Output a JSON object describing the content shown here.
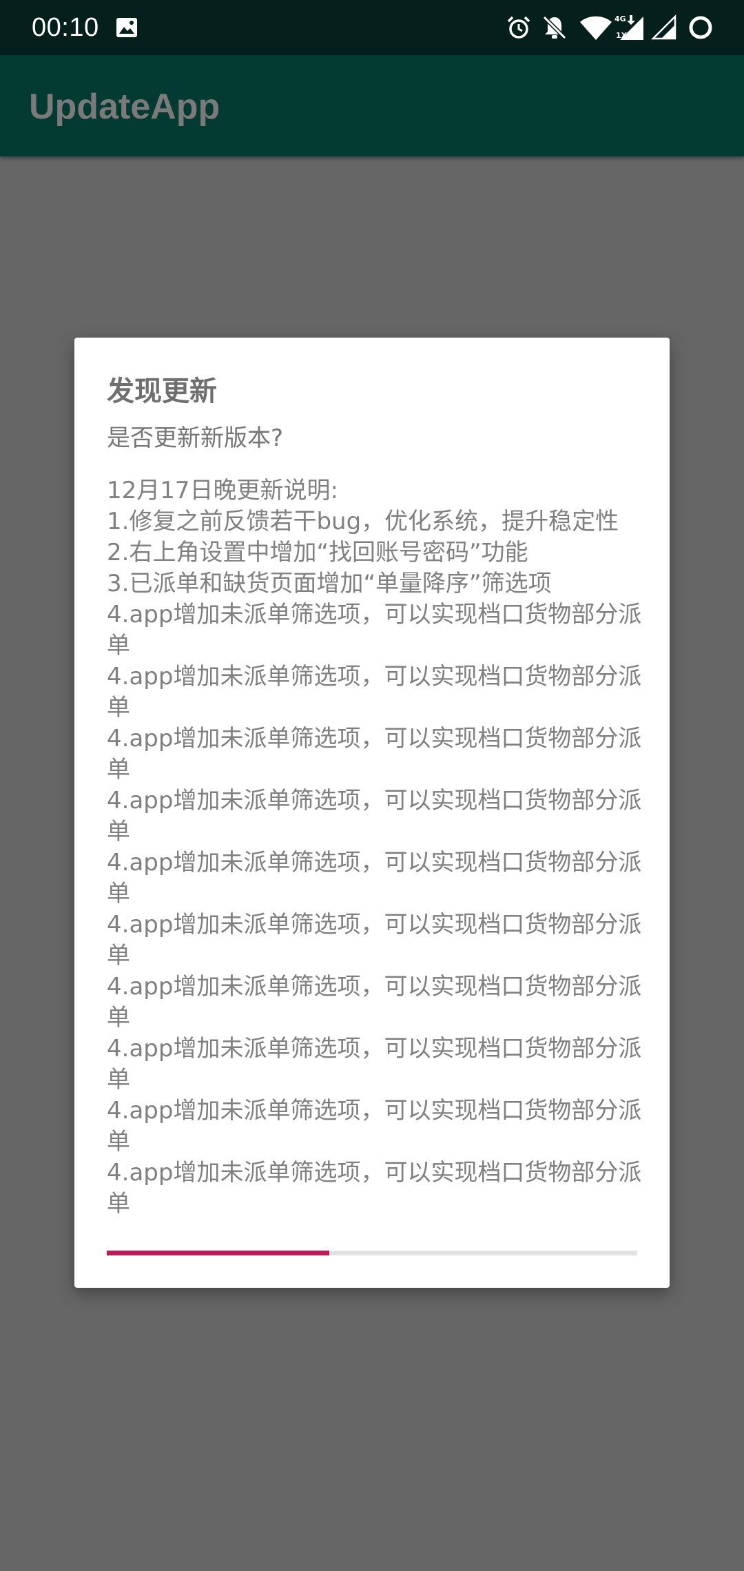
{
  "status_bar": {
    "time": "00:10",
    "icons": [
      "image-notification-icon",
      "alarm-icon",
      "notifications-off-icon",
      "wifi-icon",
      "mobile-signal-4g-icon",
      "signal-icon",
      "battery-ring-icon"
    ],
    "network_label_top": "4G",
    "network_label_bottom": "1X"
  },
  "app_bar": {
    "title": "UpdateApp"
  },
  "dialog": {
    "title": "发现更新",
    "question": "是否更新新版本?",
    "notes": "12月17日晚更新说明:\n1.修复之前反馈若干bug，优化系统，提升稳定性\n2.右上角设置中增加“找回账号密码”功能\n3.已派单和缺货页面增加“单量降序”筛选项\n4.app增加未派单筛选项，可以实现档口货物部分派单\n4.app增加未派单筛选项，可以实现档口货物部分派单\n4.app增加未派单筛选项，可以实现档口货物部分派单\n4.app增加未派单筛选项，可以实现档口货物部分派单\n4.app增加未派单筛选项，可以实现档口货物部分派单\n4.app增加未派单筛选项，可以实现档口货物部分派单\n4.app增加未派单筛选项，可以实现档口货物部分派单\n4.app增加未派单筛选项，可以实现档口货物部分派单\n4.app增加未派单筛选项，可以实现档口货物部分派单\n4.app增加未派单筛选项，可以实现档口货物部分派单",
    "progress": 0.42
  },
  "colors": {
    "status_bar_bg": "#05201c",
    "app_bar_bg": "#033a31",
    "scrim": "#666666",
    "progress_accent": "#c2185b",
    "progress_track": "#e2e2e2"
  }
}
